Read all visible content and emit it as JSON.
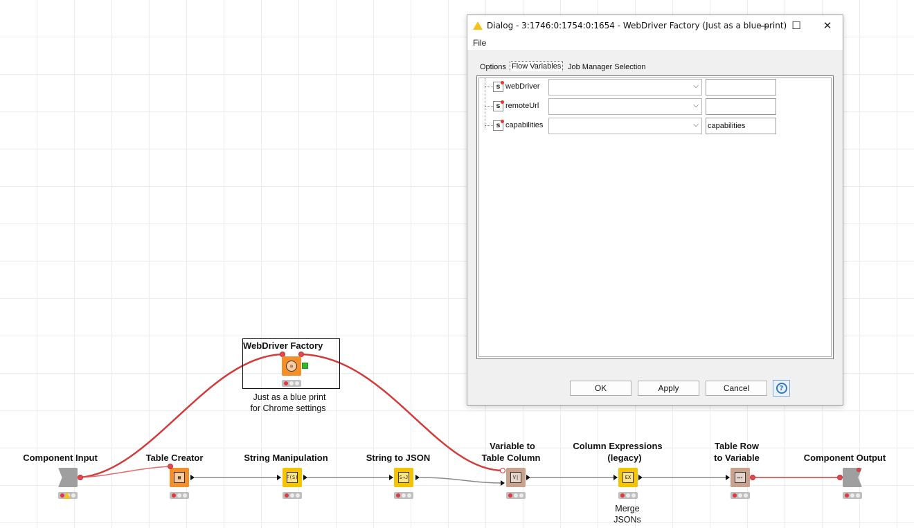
{
  "workflow": {
    "nodes": {
      "component_input": {
        "label": "Component Input"
      },
      "table_creator": {
        "label": "Table Creator"
      },
      "string_manipulation": {
        "label": "String Manipulation"
      },
      "string_to_json": {
        "label": "String to JSON"
      },
      "variable_to_table_column": {
        "label_line1": "Variable to",
        "label_line2": "Table Column"
      },
      "column_expressions": {
        "label_line1": "Column Expressions",
        "label_line2": "(legacy)",
        "comment_line1": "Merge",
        "comment_line2": "JSONs"
      },
      "table_row_to_variable": {
        "label_line1": "Table Row",
        "label_line2": "to Variable"
      },
      "component_output": {
        "label": "Component Output"
      },
      "webdriver_factory": {
        "label": "WebDriver Factory",
        "comment_line1": "Just as a blue print",
        "comment_line2": "for Chrome settings"
      }
    },
    "icons": {
      "table_creator": "▦",
      "string_manipulation": "F(S)",
      "string_to_json": "S⇢J",
      "variable_to_table_column": "V|",
      "column_expressions": "EX",
      "table_row_to_variable": "▭▿",
      "webdriver_factory": "◎"
    },
    "colors": {
      "manipulator": "#f5c400",
      "source": "#f58f2a",
      "flow": "#c8a28c",
      "component": "#9f9f9f",
      "variable_wire": "#d33a3a",
      "data_wire": "#8a8a8a",
      "status_red": "#e0393e",
      "warning": "#f6c21b"
    }
  },
  "dialog": {
    "title": "Dialog - 3:1746:0:1754:0:1654 - WebDriver Factory (Just as a blue print)",
    "menu": {
      "file": "File"
    },
    "tabs": [
      {
        "label": "Options"
      },
      {
        "label": "Flow Variables"
      },
      {
        "label": "Job Manager Selection"
      }
    ],
    "flow_variables": [
      {
        "name": "webDriver",
        "selected": "",
        "value": ""
      },
      {
        "name": "remoteUrl",
        "selected": "",
        "value": ""
      },
      {
        "name": "capabilities",
        "selected": "",
        "value": "capabilities"
      }
    ],
    "buttons": {
      "ok": "OK",
      "apply": "Apply",
      "cancel": "Cancel",
      "help": "?"
    },
    "window_controls": {
      "minimize": "—",
      "maximize": "☐",
      "close": "✕"
    }
  }
}
